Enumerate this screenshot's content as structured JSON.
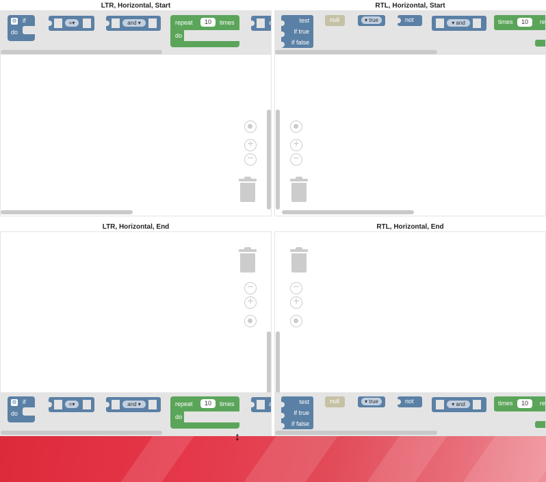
{
  "panels": [
    {
      "id": "ltr-start",
      "title": "LTR, Horizontal, Start"
    },
    {
      "id": "rtl-start",
      "title": "RTL, Horizontal, Start"
    },
    {
      "id": "ltr-end",
      "title": "LTR, Horizontal, End"
    },
    {
      "id": "rtl-end",
      "title": "RTL, Horizontal, End"
    }
  ],
  "blocks": {
    "if": "if",
    "do": "do",
    "compare_op": "=",
    "logic_op": "and",
    "repeat": "repeat",
    "repeat_count": "10",
    "times": "times",
    "test": "test",
    "if_true": "if true",
    "if_false": "if false",
    "null": "null",
    "true_value": "true",
    "not": "not",
    "dropdown_arrow": "▾",
    "truncated_a": "a",
    "truncated_re": "re"
  },
  "controls": {
    "zoom_in": "+",
    "zoom_out": "−"
  },
  "colors": {
    "logic_blue": "#5b80a5",
    "loop_green": "#5ba55b",
    "null_beige": "#c5c1a5",
    "flyout_bg": "#e4e4e4",
    "scrollbar": "#c9c9c9",
    "desktop_red": "#e5384a"
  },
  "icons": [
    "gear-icon",
    "recenter-icon",
    "zoom-in-icon",
    "zoom-out-icon",
    "trash-icon",
    "resize-cursor-icon"
  ]
}
